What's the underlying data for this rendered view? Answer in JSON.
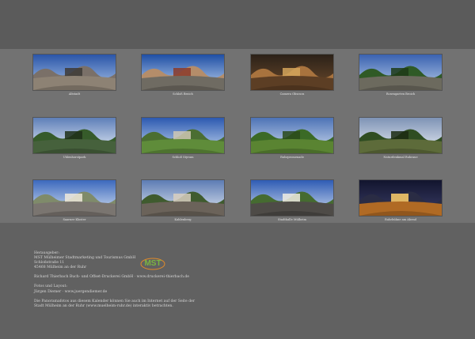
{
  "gallery": [
    {
      "caption": "Altstadt",
      "scene": "plaza"
    },
    {
      "caption": "Schloß Broich",
      "scene": "river-house"
    },
    {
      "caption": "Camera Obscura",
      "scene": "interior"
    },
    {
      "caption": "Rosengarten Broich",
      "scene": "park"
    },
    {
      "caption": "Uhlenhorstpark",
      "scene": "pond"
    },
    {
      "caption": "Schloß Styrum",
      "scene": "lawn-house"
    },
    {
      "caption": "Ruhrpromenade",
      "scene": "meadow"
    },
    {
      "caption": "Naturdenkmal Ruhraue",
      "scene": "trees"
    },
    {
      "caption": "Saarner Kloster",
      "scene": "building"
    },
    {
      "caption": "Kahlenberg",
      "scene": "street"
    },
    {
      "caption": "Stadthalle Mülheim",
      "scene": "villa"
    },
    {
      "caption": "Ruhrbühne am Abend",
      "scene": "night-stage"
    }
  ],
  "footer": {
    "publisher_label": "Herausgeber:",
    "publisher_name": "MST Mülheimer Stadtmarketing und Tourismus GmbH",
    "street": "Schloßstraße 11",
    "city": "45468 Mülheim an der Ruhr",
    "printer": "Richard Thierbach Buch- und Offset-Druckerei GmbH   ·   www.druckerei-thierbach.de",
    "photo_label": "Fotos und Layout:",
    "photographer": "Jürgen Diemer   ·   www.juergendiemer.de",
    "note_line1": "Die Panoramafotos aus diesem Kalender können Sie auch im Internet auf der Seite der",
    "note_line2": "Stadt Mülheim an der Ruhr (www.muelheim-ruhr.de) interaktiv betrachten."
  },
  "logo": {
    "text": "MST"
  },
  "colors": {
    "page": "#616161",
    "grid_band": "#727272",
    "logo_green": "#7bb540",
    "logo_orange": "#e08a2a"
  }
}
